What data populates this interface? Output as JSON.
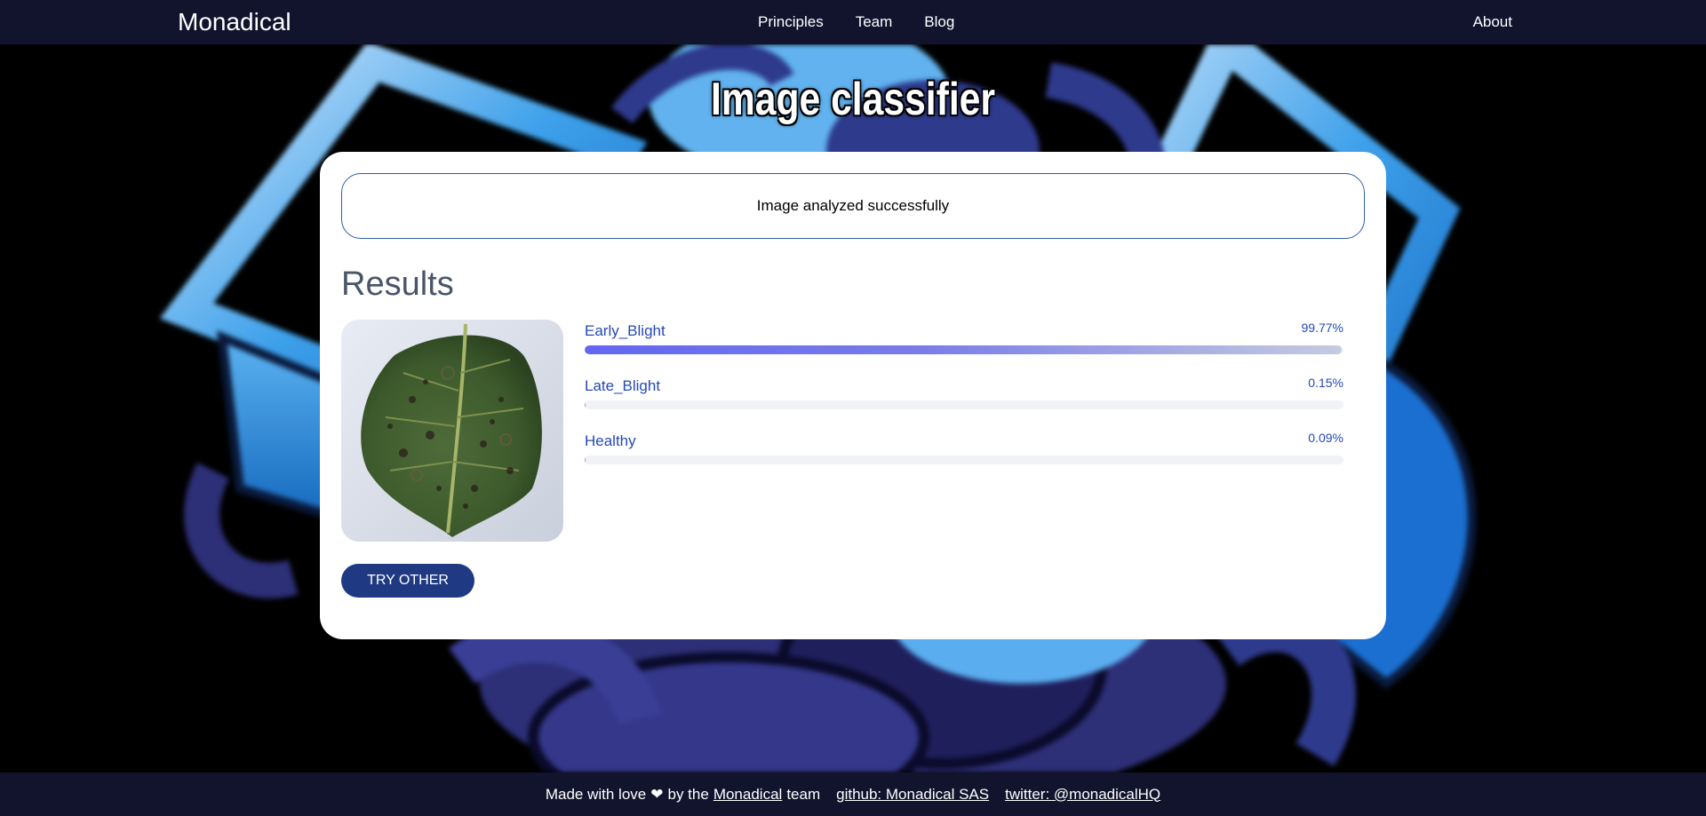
{
  "navbar": {
    "brand": "Monadical",
    "links": [
      {
        "label": "Principles"
      },
      {
        "label": "Team"
      },
      {
        "label": "Blog"
      }
    ],
    "about": "About"
  },
  "page": {
    "title": "Image classifier"
  },
  "card": {
    "status": "Image analyzed successfully",
    "results_heading": "Results",
    "image_alt": "potato leaf",
    "predictions": [
      {
        "label": "Early_Blight",
        "value_text": "99.77%",
        "value": 99.77
      },
      {
        "label": "Late_Blight",
        "value_text": "0.15%",
        "value": 0.15
      },
      {
        "label": "Healthy",
        "value_text": "0.09%",
        "value": 0.09
      }
    ],
    "try_button": "TRY OTHER"
  },
  "footer": {
    "made_with": "Made with love",
    "heart": "❤",
    "by_the": "by the",
    "monadical_link": "Monadical",
    "team": "team",
    "github": "github: Monadical SAS",
    "twitter": "twitter: @monadicalHQ"
  },
  "colors": {
    "nav_bg": "#12142e",
    "accent": "#2449b8",
    "button": "#1f3a82",
    "bar_start": "#6466f0",
    "bar_end": "#c5cbe0"
  }
}
